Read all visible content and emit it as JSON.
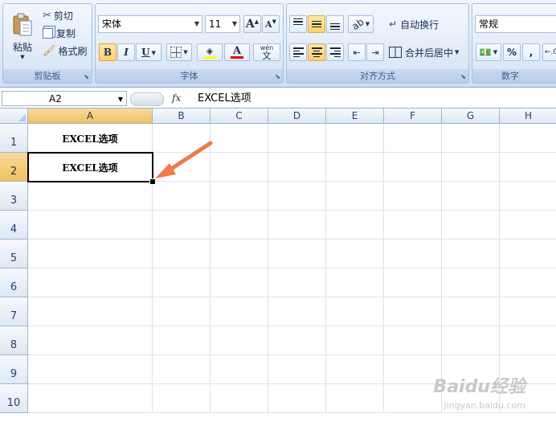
{
  "ribbon": {
    "clipboard": {
      "paste": "粘贴",
      "cut": "剪切",
      "copy": "复制",
      "format_painter": "格式刷",
      "label": "剪贴板"
    },
    "font": {
      "name": "宋体",
      "size": "11",
      "grow": "A",
      "shrink": "A",
      "bold": "B",
      "italic": "I",
      "underline": "U",
      "font_color_glyph": "A",
      "phonetic": "wén",
      "label": "字体"
    },
    "alignment": {
      "wrap_text": "自动换行",
      "merge_center": "合并后居中",
      "label": "对齐方式"
    },
    "number": {
      "format": "常规",
      "percent": "%",
      "comma": ",",
      "label": "数字"
    }
  },
  "formula_bar": {
    "name_box": "A2",
    "fx": "fx",
    "content": "EXCEL选项"
  },
  "sheet": {
    "columns": [
      "A",
      "B",
      "C",
      "D",
      "E",
      "F",
      "G",
      "H"
    ],
    "rows": [
      "1",
      "2",
      "3",
      "4",
      "5",
      "6",
      "7",
      "8",
      "9",
      "10"
    ],
    "cells": {
      "A1": "EXCEL选项",
      "A2": "EXCEL选项"
    },
    "selected_cell": "A2"
  },
  "annotation": {
    "arrow_color": "#f07a4a"
  },
  "watermark": {
    "text": "Baidu经验",
    "url": "jingyan.baidu.com"
  },
  "colors": {
    "accent_selected": "#f1c15f",
    "header_blue": "#27416b"
  }
}
